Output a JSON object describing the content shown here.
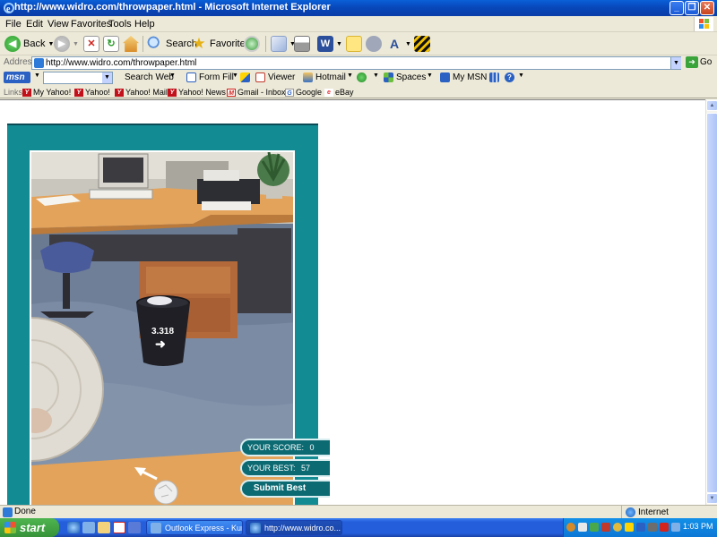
{
  "window": {
    "title": "http://www.widro.com/throwpaper.html - Microsoft Internet Explorer",
    "btn_min": "_",
    "btn_max": "❐",
    "btn_close": "✕"
  },
  "menu": {
    "items": [
      "File",
      "Edit",
      "View",
      "Favorites",
      "Tools",
      "Help"
    ]
  },
  "toolbar": {
    "back_label": "Back",
    "search_label": "Search",
    "favorites_label": "Favorites"
  },
  "address": {
    "label": "Address",
    "url": "http://www.widro.com/throwpaper.html",
    "go_label": "Go"
  },
  "msn": {
    "logo": "msn",
    "search_web": "Search Web",
    "form_fill": "Form Fill",
    "viewer": "Viewer",
    "hotmail": "Hotmail",
    "spaces": "Spaces",
    "my_msn": "My MSN"
  },
  "links": {
    "label": "Links",
    "items": [
      "My Yahoo!",
      "Yahoo!",
      "Yahoo! Mail",
      "Yahoo! News",
      "Gmail - Inbox",
      "Google",
      "eBay"
    ]
  },
  "game": {
    "can_speed": "3.318",
    "your_score_label": "YOUR SCORE:",
    "your_score": "0",
    "your_best_label": "YOUR BEST:",
    "your_best": "57",
    "submit_label": "Submit Best"
  },
  "status": {
    "text": "Done",
    "zone": "Internet"
  },
  "taskbar": {
    "start_label": "start",
    "tasks": [
      "Outlook Express - Kur...",
      "http://www.widro.co..."
    ],
    "clock": "1:03 PM"
  }
}
